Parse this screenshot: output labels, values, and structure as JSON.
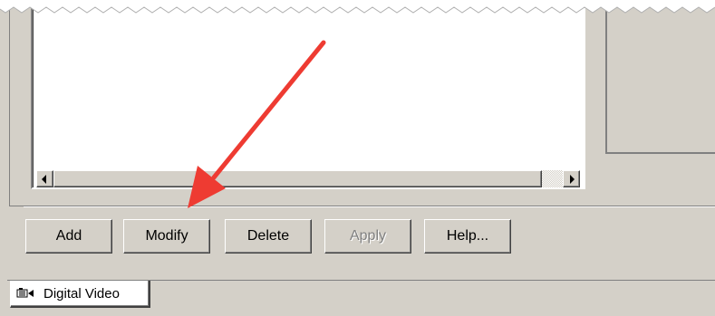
{
  "buttons": {
    "add": "Add",
    "modify": "Modify",
    "delete": "Delete",
    "apply": "Apply",
    "help": "Help..."
  },
  "tab": {
    "label": "Digital Video",
    "icon": "video-camera-icon"
  },
  "annotation": {
    "color": "#ee3b32",
    "points_to": "modify-button"
  },
  "colors": {
    "face": "#d4d0c8",
    "list_background": "#ffffff"
  }
}
